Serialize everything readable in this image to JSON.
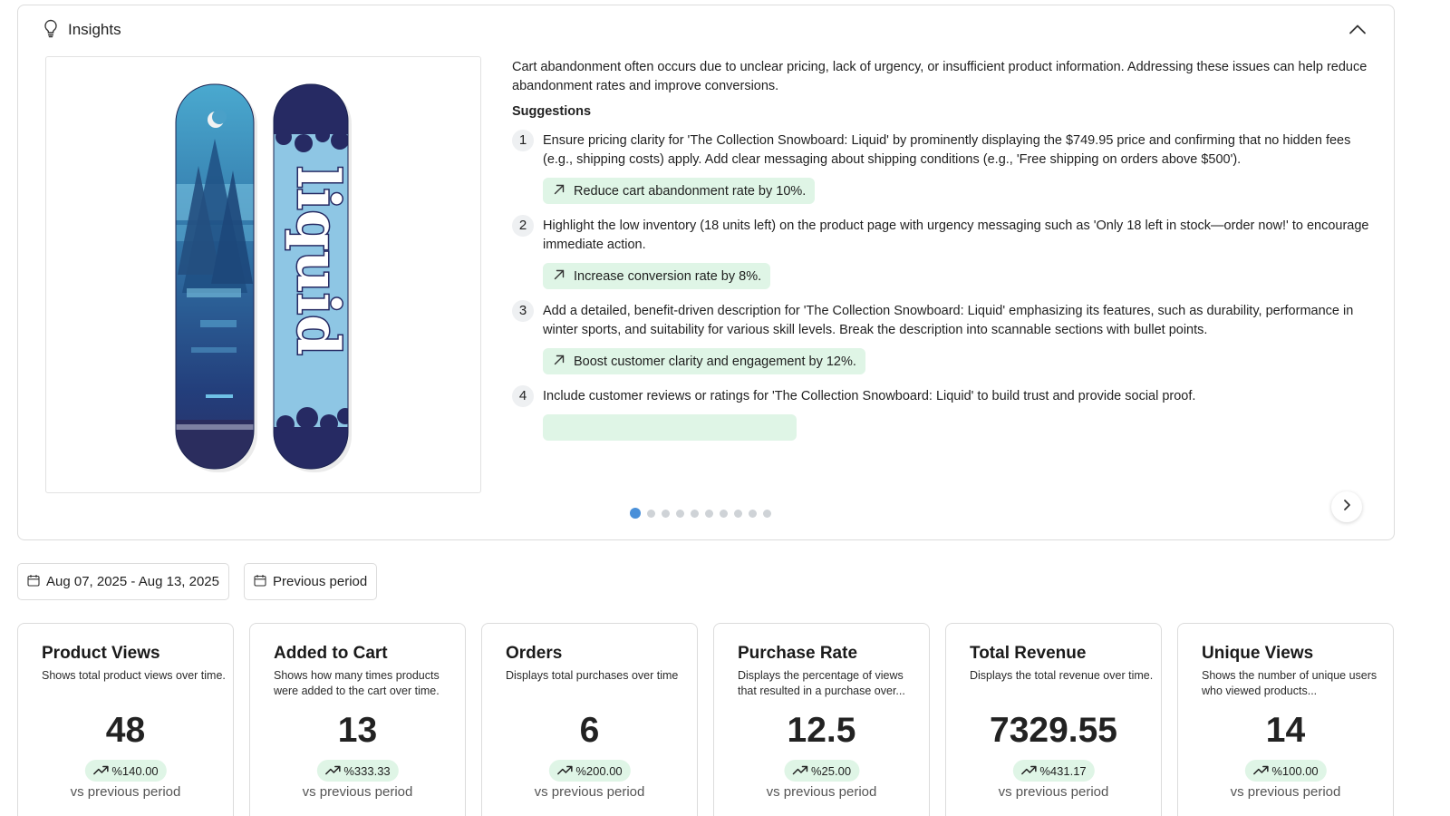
{
  "insights": {
    "title": "Insights",
    "summary": "Cart abandonment often occurs due to unclear pricing, lack of urgency, or insufficient product information. Addressing these issues can help reduce abandonment rates and improve conversions.",
    "suggestions_title": "Suggestions",
    "suggestions": [
      {
        "number": "1",
        "text": "Ensure pricing clarity for 'The Collection Snowboard: Liquid' by prominently displaying the $749.95 price and confirming that no hidden fees (e.g., shipping costs) apply. Add clear messaging about shipping conditions (e.g., 'Free shipping on orders above $500').",
        "impact": "Reduce cart abandonment rate by 10%."
      },
      {
        "number": "2",
        "text": "Highlight the low inventory (18 units left) on the product page with urgency messaging such as 'Only 18 left in stock—order now!' to encourage immediate action.",
        "impact": "Increase conversion rate by 8%."
      },
      {
        "number": "3",
        "text": "Add a detailed, benefit-driven description for 'The Collection Snowboard: Liquid' emphasizing its features, such as durability, performance in winter sports, and suitability for various skill levels. Break the description into scannable sections with bullet points.",
        "impact": "Boost customer clarity and engagement by 12%."
      },
      {
        "number": "4",
        "text": "Include customer reviews or ratings for 'The Collection Snowboard: Liquid' to build trust and provide social proof.",
        "impact": ""
      }
    ],
    "carousel_pages": 10,
    "carousel_active": 1
  },
  "filters": {
    "date_range": "Aug 07, 2025 - Aug 13, 2025",
    "compare": "Previous period"
  },
  "metrics": [
    {
      "title": "Product Views",
      "desc": "Shows total product views over time.",
      "value": "48",
      "delta": "%140.00",
      "vs": "vs previous period"
    },
    {
      "title": "Added to Cart",
      "desc": "Shows how many times products were added to the cart over time.",
      "value": "13",
      "delta": "%333.33",
      "vs": "vs previous period"
    },
    {
      "title": "Orders",
      "desc": "Displays total purchases over time",
      "value": "6",
      "delta": "%200.00",
      "vs": "vs previous period"
    },
    {
      "title": "Purchase Rate",
      "desc": "Displays the percentage of views that resulted in a purchase over...",
      "value": "12.5",
      "delta": "%25.00",
      "vs": "vs previous period"
    },
    {
      "title": "Total Revenue",
      "desc": "Displays the total revenue over time.",
      "value": "7329.55",
      "delta": "%431.17",
      "vs": "vs previous period"
    },
    {
      "title": "Unique Views",
      "desc": "Shows the number of unique users who viewed products...",
      "value": "14",
      "delta": "%100.00",
      "vs": "vs previous period"
    }
  ],
  "icons": {
    "insights": "lightbulb-icon",
    "collapse": "chevron-up-icon",
    "impact": "arrow-up-right-icon",
    "next": "chevron-right-icon",
    "date": "calendar-icon",
    "delta": "trending-up-icon"
  },
  "colors": {
    "accent": "#4a90d9",
    "positive_bg": "#dff5e6",
    "border": "#dcdcdc"
  }
}
